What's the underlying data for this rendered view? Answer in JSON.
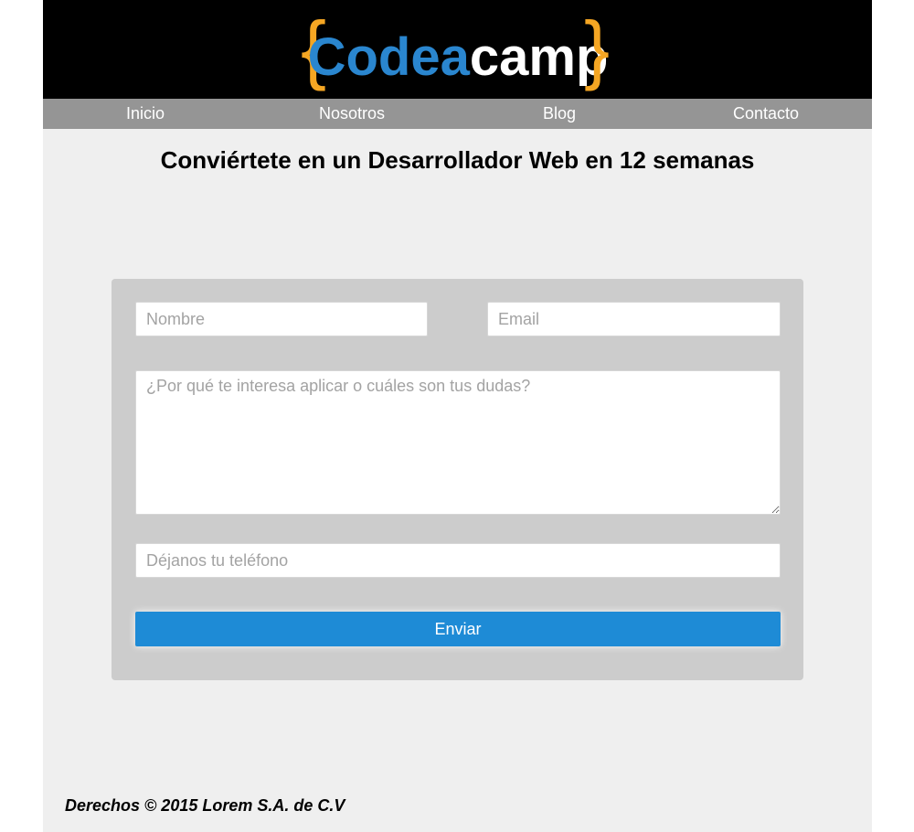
{
  "header": {
    "logo": {
      "brace_open": "{",
      "brand_part1": "Codea",
      "brand_part2": "camp",
      "brace_close": "}",
      "colors": {
        "braces": "#f5a623",
        "brand_part1": "#2a86cf",
        "brand_part2": "#ffffff"
      }
    }
  },
  "nav": {
    "items": [
      {
        "label": "Inicio"
      },
      {
        "label": "Nosotros"
      },
      {
        "label": "Blog"
      },
      {
        "label": "Contacto"
      }
    ]
  },
  "main": {
    "headline": "Conviértete en un Desarrollador Web en 12 semanas"
  },
  "form": {
    "name_placeholder": "Nombre",
    "email_placeholder": "Email",
    "message_placeholder": "¿Por qué te interesa aplicar o cuáles son tus dudas?",
    "phone_placeholder": "Déjanos tu teléfono",
    "submit_label": "Enviar"
  },
  "footer": {
    "copyright": "Derechos © 2015 Lorem S.A. de C.V"
  },
  "colors": {
    "header_bg": "#000000",
    "nav_bg": "#959595",
    "page_bg": "#efefef",
    "form_bg": "#cccccc",
    "button_bg": "#1e8bd6"
  }
}
